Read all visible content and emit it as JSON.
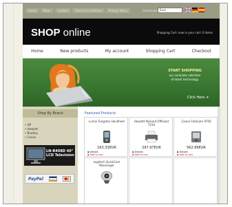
{
  "top_nav": [
    "Home",
    "News",
    "Contact",
    "Terms & Conditions",
    "Privacy Policy"
  ],
  "currency": {
    "label": "Currencies:",
    "selected": "Euro"
  },
  "flags": [
    {
      "name": "english-flag-icon",
      "colors": [
        "#1f3c88",
        "#cc2b2b"
      ]
    },
    {
      "name": "german-flag-icon",
      "colors": [
        "#111111",
        "#d42a1c",
        "#f6c600"
      ]
    },
    {
      "name": "spanish-flag-icon",
      "colors": [
        "#c60b1e",
        "#ffc400",
        "#c60b1e"
      ]
    }
  ],
  "logo": {
    "brand": "SHOP",
    "rest": " online"
  },
  "cart_summary": "Shopping Cart: now in your cart: 0 items",
  "main_menu": [
    "Home",
    "New products",
    "My account",
    "Shopping Cart",
    "Checkout"
  ],
  "banner": {
    "line1": "START SHOPPING",
    "line2": "our complete selection",
    "line3": "of latest technology.",
    "cta": "Click Here"
  },
  "sidebar": {
    "heading": "Shop By Brand",
    "brands": [
      "HP",
      "Hewlett",
      "Bradley",
      "Canon"
    ],
    "tv_promo": [
      "LN-R408D 40\"",
      "LCD Television"
    ],
    "paypal": "PayPal"
  },
  "featured": {
    "title": "Featured Products",
    "products": [
      {
        "name": "Lumix Tungsten Handheld",
        "price": "163.33EUR",
        "details": "Details",
        "cart": "Add to cart",
        "icon": "handheld-icon"
      },
      {
        "name": "Hewlett Packard Officejet 7210",
        "price": "297.97EUR",
        "details": "Details",
        "cart": "Add to cart",
        "icon": "printer-icon"
      },
      {
        "name": "Canon FotoCam 9700",
        "price": "562.89EUR",
        "details": "Details",
        "cart": "Add to cart",
        "icon": "camera-icon"
      },
      {
        "name": "Logitech QuickCam Messenger",
        "price": "",
        "details": "",
        "cart": "",
        "icon": "webcam-icon"
      }
    ]
  },
  "colors": {
    "topbar": "#9c9c86",
    "header": "#0b0b0b",
    "banner": "#3a7731",
    "sidebar": "#d9d5bc",
    "link_red": "#c62020",
    "featured_blue": "#2d62b0"
  }
}
